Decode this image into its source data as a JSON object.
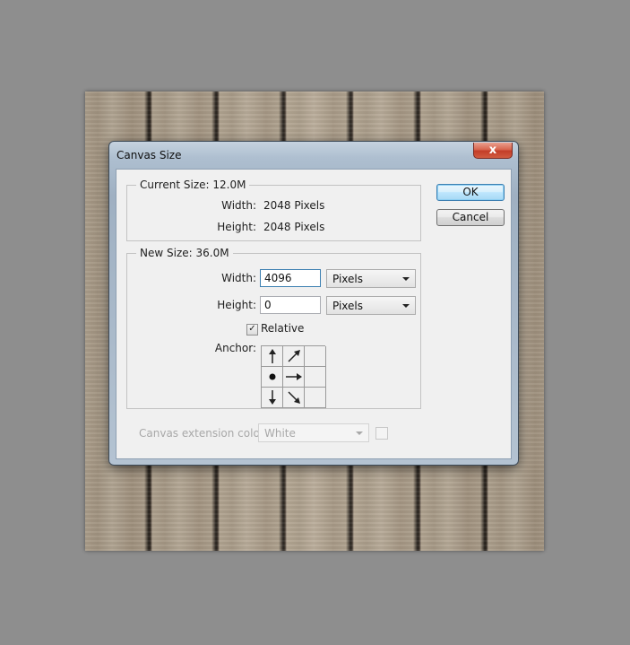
{
  "dialog": {
    "title": "Canvas Size",
    "close_symbol": "x"
  },
  "current_size": {
    "legend": "Current Size: 12.0M",
    "width_label": "Width:",
    "width_value": "2048 Pixels",
    "height_label": "Height:",
    "height_value": "2048 Pixels"
  },
  "new_size": {
    "legend": "New Size: 36.0M",
    "width_label": "Width:",
    "width_value": "4096",
    "width_unit": "Pixels",
    "height_label": "Height:",
    "height_value": "0",
    "height_unit": "Pixels",
    "relative_label": "Relative",
    "relative_checked": true,
    "anchor_label": "Anchor:",
    "anchor_selected": "middle-left"
  },
  "buttons": {
    "ok": "OK",
    "cancel": "Cancel"
  },
  "extension": {
    "label": "Canvas extension color:",
    "value": "White"
  },
  "colors": {
    "default_button_border": "#3c7fb1",
    "close_button": "#c33d28"
  }
}
